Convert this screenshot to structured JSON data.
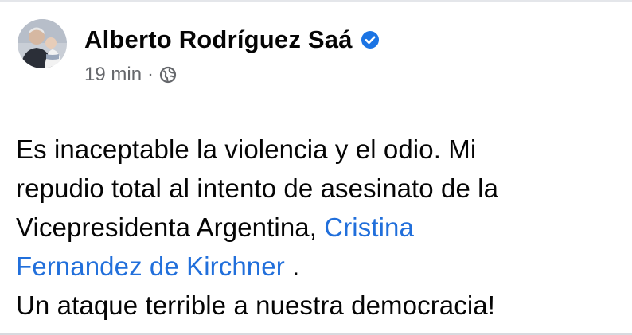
{
  "author": {
    "name": "Alberto Rodríguez Saá",
    "verified_icon": "verified-badge-icon",
    "avatar_icon": "profile-photo"
  },
  "post_meta": {
    "time": "19 min",
    "separator": "·",
    "audience_icon": "globe-icon"
  },
  "post_text": {
    "line1": "Es inaceptable la violencia y el odio. Mi",
    "line2": "repudio total al intento de asesinato de la",
    "line3_before": "Vicepresidenta Argentina, ",
    "mention_part1": "Cristina",
    "mention_part2": "Fernandez de Kirchner",
    "line4_after": " .",
    "line5": "Un ataque terrible a nuestra democracia!"
  },
  "colors": {
    "mention": "#216fdb",
    "verified": "#1b74e4",
    "meta": "#65676b"
  }
}
